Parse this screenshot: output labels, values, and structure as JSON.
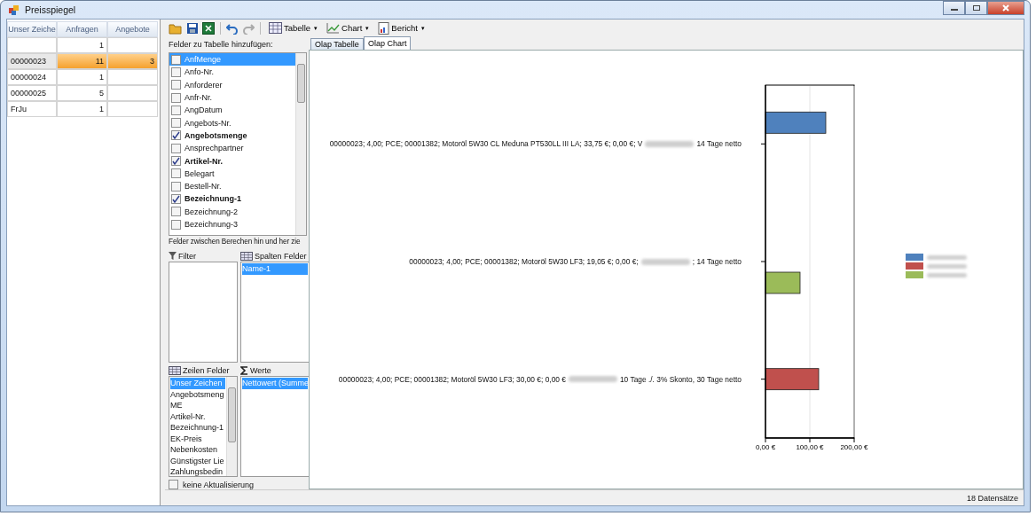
{
  "window": {
    "title": "Preisspiegel"
  },
  "summary_table": {
    "columns": [
      "Unser Zeiche",
      "Anfragen",
      "Angebote"
    ],
    "rows": [
      {
        "cells": [
          "",
          "1",
          ""
        ],
        "selected": false
      },
      {
        "cells": [
          "00000023",
          "11",
          "3"
        ],
        "selected": true
      },
      {
        "cells": [
          "00000024",
          "1",
          ""
        ],
        "selected": false
      },
      {
        "cells": [
          "00000025",
          "5",
          ""
        ],
        "selected": false
      },
      {
        "cells": [
          "FrJu",
          "1",
          ""
        ],
        "selected": false
      }
    ]
  },
  "toolbar": {
    "menus": [
      {
        "label": "Tabelle",
        "caret": "▾"
      },
      {
        "label": "Chart",
        "caret": "▾"
      },
      {
        "label": "Bericht",
        "caret": "▾"
      }
    ]
  },
  "field_panel": {
    "title": "Felder zu Tabelle hinzufügen:",
    "fields": [
      {
        "label": "AnfMenge",
        "checked": false,
        "selected": true
      },
      {
        "label": "Anfo-Nr.",
        "checked": false,
        "selected": false
      },
      {
        "label": "Anforderer",
        "checked": false,
        "selected": false
      },
      {
        "label": "Anfr-Nr.",
        "checked": false,
        "selected": false
      },
      {
        "label": "AngDatum",
        "checked": false,
        "selected": false
      },
      {
        "label": "Angebots-Nr.",
        "checked": false,
        "selected": false
      },
      {
        "label": "Angebotsmenge",
        "checked": true,
        "selected": false
      },
      {
        "label": "Ansprechpartner",
        "checked": false,
        "selected": false
      },
      {
        "label": "Artikel-Nr.",
        "checked": true,
        "selected": false
      },
      {
        "label": "Belegart",
        "checked": false,
        "selected": false
      },
      {
        "label": "Bestell-Nr.",
        "checked": false,
        "selected": false
      },
      {
        "label": "Bezeichnung-1",
        "checked": true,
        "selected": false
      },
      {
        "label": "Bezeichnung-2",
        "checked": false,
        "selected": false
      },
      {
        "label": "Bezeichnung-3",
        "checked": false,
        "selected": false
      }
    ],
    "hint": "Felder zwischen Berechen hin und her zie",
    "areas": [
      {
        "title": "Filter",
        "kind": "filter"
      },
      {
        "title": "Spalten Felder",
        "kind": "columns",
        "items": [
          {
            "label": "Name-1",
            "selected": true
          }
        ]
      },
      {
        "title": "Zeilen Felder",
        "kind": "rows",
        "items": [
          {
            "label": "Unser Zeichen",
            "selected": true
          },
          {
            "label": "Angebotsmeng",
            "selected": false
          },
          {
            "label": "ME",
            "selected": false
          },
          {
            "label": "Artikel-Nr.",
            "selected": false
          },
          {
            "label": "Bezeichnung-1",
            "selected": false
          },
          {
            "label": "EK-Preis",
            "selected": false
          },
          {
            "label": "Nebenkosten",
            "selected": false
          },
          {
            "label": "Günstigster Lie",
            "selected": false
          },
          {
            "label": "Zahlungsbedin",
            "selected": false
          }
        ]
      },
      {
        "title": "Werte",
        "kind": "values",
        "items": [
          {
            "label": "Nettowert (Summe",
            "selected": true
          }
        ]
      }
    ],
    "no_update": {
      "label": "keine Aktualisierung",
      "checked": false
    }
  },
  "tabs": [
    {
      "label": "Olap Tabelle",
      "selected": false
    },
    {
      "label": "Olap Chart",
      "selected": true
    }
  ],
  "chart": {
    "bar_labels": [
      {
        "before": "00000023; 4,00; PCE; 00001382; Motoröl 5W30 CL Meduna PT530LL III LA; 33,75 €; 0,00 €; V",
        "after": "14 Tage netto"
      },
      {
        "before": "00000023; 4,00; PCE; 00001382; Motoröl 5W30 LF3; 19,05 €; 0,00 €;",
        "after": "; 14 Tage netto"
      },
      {
        "before": "00000023; 4,00; PCE; 00001382; Motoröl 5W30 LF3; 30,00 €; 0,00 €",
        "after": "10 Tage ./. 3% Skonto, 30 Tage netto"
      }
    ],
    "chart_data": {
      "type": "bar",
      "orientation": "horizontal",
      "series": [
        {
          "color": "#4f81bd",
          "values": [
            136,
            null,
            null
          ]
        },
        {
          "color": "#c0504d",
          "values": [
            null,
            null,
            120
          ]
        },
        {
          "color": "#9bbb59",
          "values": [
            null,
            78,
            null
          ]
        }
      ],
      "xlim": [
        0,
        200
      ],
      "xticks": [
        {
          "value": 0,
          "label": "0,00 €"
        },
        {
          "value": 100,
          "label": "100,00 €"
        },
        {
          "value": 200,
          "label": "200,00 €"
        }
      ]
    }
  },
  "status_bar": {
    "text": "18 Datensätze"
  }
}
